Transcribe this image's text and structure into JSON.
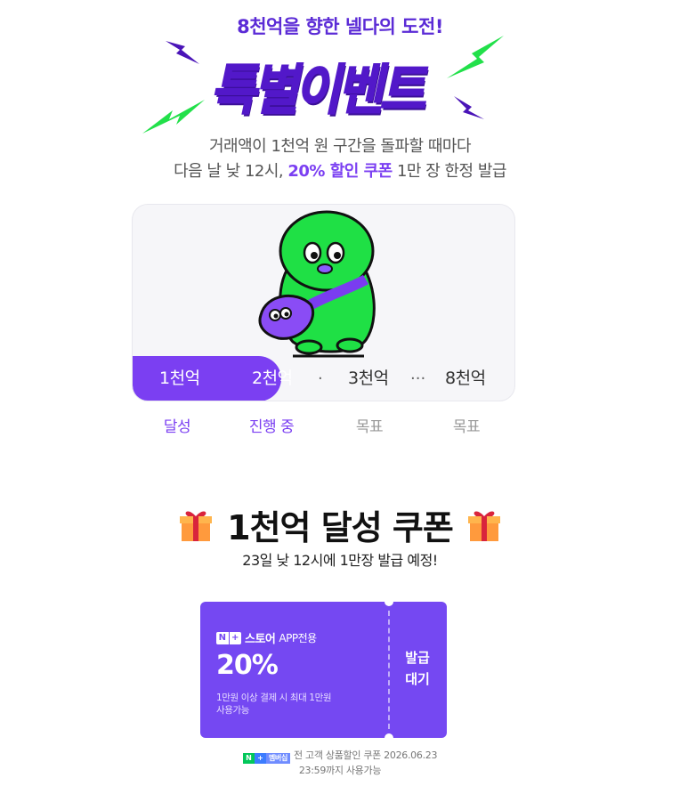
{
  "headline": "8천억을 향한 넬다의 도전!",
  "event_title": "특별이벤트",
  "description": {
    "line1": "거래액이 1천억 원 구간을 돌파할 때마다",
    "line2_prefix": "다음 날 낮 12시, ",
    "line2_highlight": "20% 할인 쿠폰",
    "line2_suffix": " 1만 장 한정 발급"
  },
  "progress": {
    "milestones": [
      "1천억",
      "2천억",
      "3천억",
      "8천억"
    ],
    "separators": [
      "·",
      "···"
    ],
    "statuses": [
      "달성",
      "진행 중",
      "목표",
      "목표"
    ],
    "fill_fraction": 0.39
  },
  "coupon_section": {
    "title": "1천억 달성 쿠폰",
    "subtitle": "23일 낮 12시에 1만장 발급 예정!"
  },
  "coupon": {
    "badge_n": "N",
    "badge_plus": "+",
    "brand": "스토어",
    "brand_sub": "APP전용",
    "discount": "20%",
    "condition_line1": "1만원 이상 결제 시 최대 1만원",
    "condition_line2": "사용가능",
    "issue_line1": "발급",
    "issue_line2": "대기",
    "color": "#7548f2"
  },
  "footer": {
    "badge_text": "멤버십",
    "line1": "전 고객 상품할인 쿠폰 2026.06.23",
    "line2": "23:59까지 사용가능"
  },
  "colors": {
    "accent": "#7b3ff2",
    "title_purple": "#5218c9",
    "bolt_green": "#22e04a",
    "bolt_purple": "#4a14b8"
  }
}
